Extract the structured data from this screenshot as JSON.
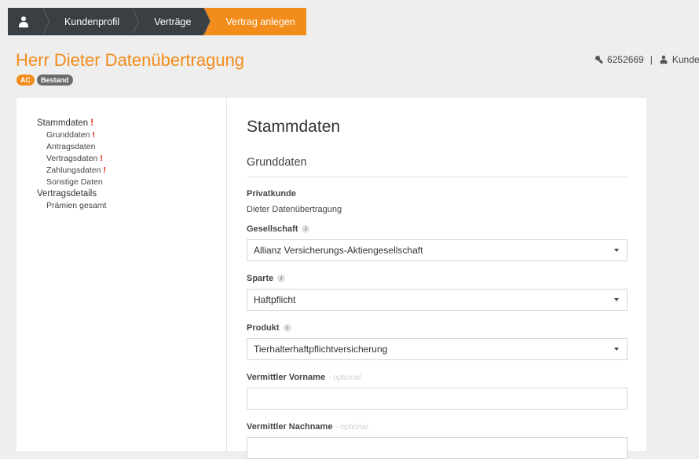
{
  "breadcrumb": {
    "items": [
      "Kundenprofil",
      "Verträge",
      "Vertrag anlegen"
    ]
  },
  "header": {
    "title": "Herr Dieter Datenübertragung",
    "badges": [
      "AC",
      "Bestand"
    ],
    "id_number": "6252669",
    "separator": "|",
    "user_label": "Kunde"
  },
  "sidebar": {
    "items": [
      {
        "label": "Stammdaten",
        "required": "!"
      },
      {
        "label": "Grunddaten",
        "required": "!"
      },
      {
        "label": "Antragsdaten"
      },
      {
        "label": "Vertragsdaten",
        "required": "!"
      },
      {
        "label": "Zahlungsdaten",
        "required": "!"
      },
      {
        "label": "Sonstige Daten"
      },
      {
        "label": "Vertragsdetails"
      },
      {
        "label": "Prämien gesamt"
      }
    ]
  },
  "form": {
    "title": "Stammdaten",
    "section": "Grunddaten",
    "privatkunde_label": "Privatkunde",
    "privatkunde_value": "Dieter Datenübertragung",
    "gesellschaft_label": "Gesellschaft",
    "gesellschaft_value": "Allianz Versicherungs-Aktiengesellschaft",
    "sparte_label": "Sparte",
    "sparte_value": "Haftpflicht",
    "produkt_label": "Produkt",
    "produkt_value": "Tierhalterhaftpflichtversicherung",
    "vermittler_vorname_label": "Vermittler Vorname",
    "vermittler_nachname_label": "Vermittler Nachname",
    "optional_text": "- optional",
    "info_glyph": "i"
  },
  "colors": {
    "accent": "#f28c1a",
    "dark": "#3a3f44",
    "required": "#e0200e"
  }
}
